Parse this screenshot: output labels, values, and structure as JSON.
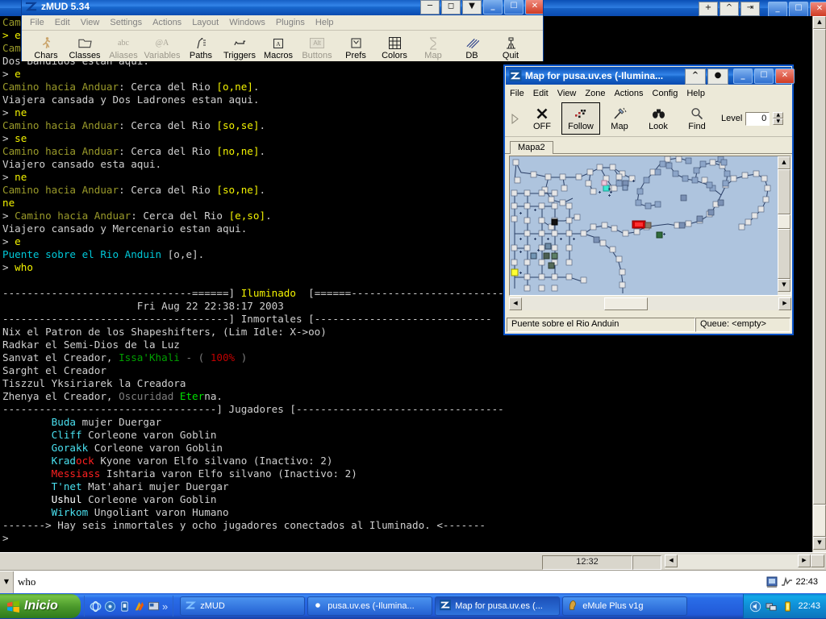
{
  "desktop": {
    "background_color": "#3a6ea5"
  },
  "mud_window": {
    "title": "",
    "window_buttons": [
      "+",
      "^",
      "⇥",
      "_",
      "❐",
      "✕"
    ],
    "screen_lines": [
      [
        {
          "t": "Cam",
          "c": "c-olive"
        }
      ],
      [
        {
          "t": "> e",
          "c": "c-yellow"
        }
      ],
      [
        {
          "t": "Cam",
          "c": "c-olive"
        }
      ],
      [
        {
          "t": "Dos Bandidos estan aqui.",
          "c": "c-white"
        }
      ],
      [
        {
          "t": "> ",
          "c": "c-white"
        },
        {
          "t": "e",
          "c": "c-yellow"
        }
      ],
      [
        {
          "t": "Camino hacia Anduar",
          "c": "c-olive"
        },
        {
          "t": ": Cerca del Rio ",
          "c": "c-white"
        },
        {
          "t": "[o,ne]",
          "c": "c-yellow"
        },
        {
          "t": ".",
          "c": "c-white"
        }
      ],
      [
        {
          "t": "Viajera cansada y Dos Ladrones estan aqui.",
          "c": "c-white"
        }
      ],
      [
        {
          "t": "> ",
          "c": "c-white"
        },
        {
          "t": "ne",
          "c": "c-yellow"
        }
      ],
      [
        {
          "t": "Camino hacia Anduar",
          "c": "c-olive"
        },
        {
          "t": ": Cerca del Rio ",
          "c": "c-white"
        },
        {
          "t": "[so,se]",
          "c": "c-yellow"
        },
        {
          "t": ".",
          "c": "c-white"
        }
      ],
      [
        {
          "t": "> ",
          "c": "c-white"
        },
        {
          "t": "se",
          "c": "c-yellow"
        }
      ],
      [
        {
          "t": "Camino hacia Anduar",
          "c": "c-olive"
        },
        {
          "t": ": Cerca del Rio ",
          "c": "c-white"
        },
        {
          "t": "[no,ne]",
          "c": "c-yellow"
        },
        {
          "t": ".",
          "c": "c-white"
        }
      ],
      [
        {
          "t": "Viajero cansado esta aqui.",
          "c": "c-white"
        }
      ],
      [
        {
          "t": "> ",
          "c": "c-white"
        },
        {
          "t": "ne",
          "c": "c-yellow"
        }
      ],
      [
        {
          "t": "Camino hacia Anduar",
          "c": "c-olive"
        },
        {
          "t": ": Cerca del Rio ",
          "c": "c-white"
        },
        {
          "t": "[so,ne]",
          "c": "c-yellow"
        },
        {
          "t": ".",
          "c": "c-white"
        }
      ],
      [
        {
          "t": "ne",
          "c": "c-yellow"
        }
      ],
      [
        {
          "t": "> ",
          "c": "c-white"
        },
        {
          "t": "Camino hacia Anduar",
          "c": "c-olive"
        },
        {
          "t": ": Cerca del Rio ",
          "c": "c-white"
        },
        {
          "t": "[e,so]",
          "c": "c-yellow"
        },
        {
          "t": ".",
          "c": "c-white"
        }
      ],
      [
        {
          "t": "Viajero cansado y Mercenario estan aqui.",
          "c": "c-white"
        }
      ],
      [
        {
          "t": "> ",
          "c": "c-white"
        },
        {
          "t": "e",
          "c": "c-yellow"
        }
      ],
      [
        {
          "t": "Puente sobre el Rio Anduin",
          "c": "c-cyan"
        },
        {
          "t": " [o,e].",
          "c": "c-white"
        }
      ],
      [
        {
          "t": "> ",
          "c": "c-white"
        },
        {
          "t": "who",
          "c": "c-yellow"
        }
      ],
      [
        {
          "t": "",
          "c": "c-white"
        }
      ],
      [
        {
          "t": "-------------------------------======] ",
          "c": "c-white"
        },
        {
          "t": "Iluminado",
          "c": "c-yellow"
        },
        {
          "t": "  [======-------------------------------",
          "c": "c-white"
        }
      ],
      [
        {
          "t": "                      Fri Aug 22 22:38:17 2003",
          "c": "c-white"
        }
      ],
      [
        {
          "t": "-------------------------------------] Inmortales [-----------------------------",
          "c": "c-white"
        }
      ],
      [
        {
          "t": "Nix el Patron de los Shapeshifters, (Lim Idle: X->oo)",
          "c": "c-white"
        }
      ],
      [
        {
          "t": "Radkar el Semi-Dios de la Luz",
          "c": "c-white"
        }
      ],
      [
        {
          "t": "Sanvat el Creador, ",
          "c": "c-white"
        },
        {
          "t": "Issa'Khali",
          "c": "c-green"
        },
        {
          "t": " - ",
          "c": "c-gray"
        },
        {
          "t": "( ",
          "c": "c-gray"
        },
        {
          "t": "100%",
          "c": "c-red"
        },
        {
          "t": " )",
          "c": "c-gray"
        }
      ],
      [
        {
          "t": "Sarght el Creador",
          "c": "c-white"
        }
      ],
      [
        {
          "t": "Tiszzul Yksiriarek la Creadora",
          "c": "c-white"
        }
      ],
      [
        {
          "t": "Zhenya el Creador, ",
          "c": "c-white"
        },
        {
          "t": "Oscuridad ",
          "c": "c-gray"
        },
        {
          "t": "Eter",
          "c": "c-bgreen"
        },
        {
          "t": "na",
          "c": "c-white"
        },
        {
          "t": ".",
          "c": "c-white"
        }
      ],
      [
        {
          "t": "-----------------------------------] Jugadores [----------------------------------",
          "c": "c-white"
        }
      ],
      [
        {
          "t": "        ",
          "c": "c-white"
        },
        {
          "t": "Buda",
          "c": "c-bcyan"
        },
        {
          "t": " mujer Duergar",
          "c": "c-white"
        }
      ],
      [
        {
          "t": "        ",
          "c": "c-white"
        },
        {
          "t": "Cliff",
          "c": "c-bcyan"
        },
        {
          "t": " Corleone varon Goblin",
          "c": "c-white"
        }
      ],
      [
        {
          "t": "        ",
          "c": "c-white"
        },
        {
          "t": "Gorakk",
          "c": "c-bcyan"
        },
        {
          "t": " Corleone varon Goblin",
          "c": "c-white"
        }
      ],
      [
        {
          "t": "        ",
          "c": "c-white"
        },
        {
          "t": "Krad",
          "c": "c-bcyan"
        },
        {
          "t": "ock",
          "c": "c-bred"
        },
        {
          "t": " Kyone varon Elfo silvano (Inactivo: 2)",
          "c": "c-white"
        }
      ],
      [
        {
          "t": "        ",
          "c": "c-white"
        },
        {
          "t": "Messiass",
          "c": "c-bred"
        },
        {
          "t": " Ishtaria varon Elfo silvano (Inactivo: 2)",
          "c": "c-white"
        }
      ],
      [
        {
          "t": "        ",
          "c": "c-white"
        },
        {
          "t": "T'net",
          "c": "c-bcyan"
        },
        {
          "t": " Mat'ahari mujer Duergar",
          "c": "c-white"
        }
      ],
      [
        {
          "t": "        ",
          "c": "c-white"
        },
        {
          "t": "Ushul",
          "c": "c-bright"
        },
        {
          "t": " Corleone varon Goblin",
          "c": "c-white"
        }
      ],
      [
        {
          "t": "        ",
          "c": "c-white"
        },
        {
          "t": "Wirkom",
          "c": "c-bcyan"
        },
        {
          "t": " Ungoliant varon Humano",
          "c": "c-white"
        }
      ],
      [
        {
          "t": "-------> Hay seis inmortales y ocho jugadores conectados al Iluminado. <-------",
          "c": "c-white"
        }
      ],
      [
        {
          "t": ">",
          "c": "c-white"
        }
      ]
    ],
    "statusbar": {
      "clock": "12:32"
    },
    "command_line": {
      "value": "who",
      "placeholder": "",
      "time": "22:43"
    }
  },
  "zmud": {
    "title": "zMUD 5.34",
    "menu": [
      "File",
      "Edit",
      "View",
      "Settings",
      "Actions",
      "Layout",
      "Windows",
      "Plugins",
      "Help"
    ],
    "toolbar": [
      {
        "label": "Chars",
        "icon": "runner-icon",
        "dim": false
      },
      {
        "label": "Classes",
        "icon": "folder-icon",
        "dim": false
      },
      {
        "label": "Aliases",
        "icon": "abc-icon",
        "dim": true
      },
      {
        "label": "Variables",
        "icon": "at-a-icon",
        "dim": true
      },
      {
        "label": "Paths",
        "icon": "path-icon",
        "dim": false
      },
      {
        "label": "Triggers",
        "icon": "gun-icon",
        "dim": false
      },
      {
        "label": "Macros",
        "icon": "key-a-icon",
        "dim": false
      },
      {
        "label": "Buttons",
        "icon": "alt-button-icon",
        "dim": true
      },
      {
        "label": "Prefs",
        "icon": "prefs-icon",
        "dim": false
      },
      {
        "label": "Colors",
        "icon": "grid-icon",
        "dim": false
      },
      {
        "label": "Map",
        "icon": "map-icon",
        "dim": true
      },
      {
        "label": "DB",
        "icon": "db-icon",
        "dim": false
      },
      {
        "label": "Quit",
        "icon": "quit-icon",
        "dim": false
      }
    ],
    "window_buttons": [
      "_",
      "❐",
      "✕"
    ]
  },
  "map_window": {
    "title": "Map for pusa.uv.es (-Ilumina...",
    "menu": [
      "File",
      "Edit",
      "View",
      "Zone",
      "Actions",
      "Config",
      "Help"
    ],
    "toolbar": [
      {
        "label": "OFF",
        "icon": "x-icon",
        "selected": false
      },
      {
        "label": "Follow",
        "icon": "dots-icon",
        "selected": true
      },
      {
        "label": "Map",
        "icon": "wand-icon",
        "selected": false
      },
      {
        "label": "Look",
        "icon": "binoculars-icon",
        "selected": false
      },
      {
        "label": "Find",
        "icon": "magnifier-icon",
        "selected": false
      }
    ],
    "level_label": "Level",
    "level_value": "0",
    "tab": "Mapa2",
    "status_left": "Puente sobre el Rio Anduin",
    "status_right": "Queue: <empty>",
    "window_buttons": [
      "^",
      "●",
      "_",
      "❐",
      "✕"
    ],
    "canvas_bg": "#aec4de",
    "current_room_color": "#d00000"
  },
  "taskbar": {
    "start_label": "Inicio",
    "quicklaunch": [
      "ie-icon",
      "media-icon",
      "outlook-icon",
      "winamp-icon",
      "desktop-icon",
      "chevrons-icon"
    ],
    "tasks": [
      {
        "label": "zMUD",
        "icon": "zmud-icon",
        "active": false
      },
      {
        "label": "pusa.uv.es (-Ilumina...",
        "icon": "dot-icon",
        "active": false
      },
      {
        "label": "Map for pusa.uv.es (...",
        "icon": "map-icon",
        "active": true
      },
      {
        "label": "eMule Plus v1g",
        "icon": "emule-icon",
        "active": false
      }
    ],
    "tray_time": "22:43",
    "tray_icons": [
      "volume-icon",
      "network-icon",
      "battery-icon"
    ]
  }
}
